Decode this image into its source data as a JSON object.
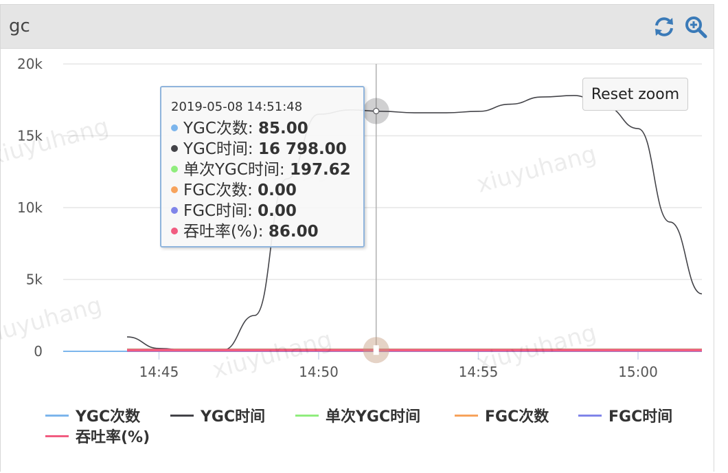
{
  "panel": {
    "title": "gc",
    "icons": [
      "refresh-icon",
      "zoom-in-icon"
    ]
  },
  "watermark": "xiuyuhang",
  "reset_zoom_label": "Reset zoom",
  "tooltip": {
    "date": "2019-05-08 14:51:48",
    "rows": [
      {
        "label": "YGC次数: ",
        "value": "85.00",
        "color": "#7cb5ec"
      },
      {
        "label": "YGC时间: ",
        "value": "16 798.00",
        "color": "#434348"
      },
      {
        "label": "单次YGC时间: ",
        "value": "197.62",
        "color": "#90ed7d"
      },
      {
        "label": "FGC次数: ",
        "value": "0.00",
        "color": "#f7a35c"
      },
      {
        "label": "FGC时间: ",
        "value": "0.00",
        "color": "#8085e9"
      },
      {
        "label": "吞吐率(%): ",
        "value": "86.00",
        "color": "#f15c80"
      }
    ]
  },
  "chart_data": {
    "type": "line",
    "title": "gc",
    "xlabel": "",
    "ylabel": "",
    "x_range": [
      "14:42",
      "15:02"
    ],
    "y_range": [
      0,
      20000
    ],
    "y_ticks": [
      0,
      5000,
      10000,
      15000,
      20000
    ],
    "y_tick_labels": [
      "0",
      "5k",
      "10k",
      "15k",
      "20k"
    ],
    "x_ticks": [
      "14:45",
      "14:50",
      "14:55",
      "15:00"
    ],
    "grid": true,
    "legend_position": "bottom",
    "crosshair_time": "14:51:48",
    "series": [
      {
        "name": "YGC次数",
        "color": "#7cb5ec",
        "points": [
          [
            "14:42",
            0
          ],
          [
            "14:44",
            0
          ]
        ]
      },
      {
        "name": "YGC时间",
        "color": "#434348",
        "points": [
          [
            "14:44",
            1000
          ],
          [
            "14:45",
            200
          ],
          [
            "14:46",
            50
          ],
          [
            "14:47",
            80
          ],
          [
            "14:48",
            2500
          ],
          [
            "14:49",
            12000
          ],
          [
            "14:50",
            16500
          ],
          [
            "14:51",
            16800
          ],
          [
            "14:52",
            16700
          ],
          [
            "14:53",
            16600
          ],
          [
            "14:54",
            16600
          ],
          [
            "14:55",
            16700
          ],
          [
            "14:56",
            17200
          ],
          [
            "14:57",
            17700
          ],
          [
            "14:58",
            17800
          ],
          [
            "14:59",
            17000
          ],
          [
            "15:00",
            15500
          ],
          [
            "15:01",
            9000
          ],
          [
            "15:02",
            4000
          ]
        ]
      },
      {
        "name": "单次YGC时间",
        "color": "#90ed7d",
        "points": [
          [
            "14:44",
            150
          ],
          [
            "15:02",
            150
          ]
        ]
      },
      {
        "name": "FGC次数",
        "color": "#f7a35c",
        "points": [
          [
            "14:44",
            0
          ],
          [
            "15:02",
            0
          ]
        ]
      },
      {
        "name": "FGC时间",
        "color": "#8085e9",
        "points": [
          [
            "14:44",
            0
          ],
          [
            "15:02",
            0
          ]
        ]
      },
      {
        "name": "吞吐率(%)",
        "color": "#f15c80",
        "points": [
          [
            "14:44",
            86
          ],
          [
            "15:02",
            86
          ]
        ]
      }
    ]
  },
  "legend": {
    "items": [
      {
        "name": "YGC次数",
        "color": "#7cb5ec"
      },
      {
        "name": "YGC时间",
        "color": "#434348"
      },
      {
        "name": "单次YGC时间",
        "color": "#90ed7d"
      },
      {
        "name": "FGC次数",
        "color": "#f7a35c"
      },
      {
        "name": "FGC时间",
        "color": "#8085e9"
      },
      {
        "name": "吞吐率(%)",
        "color": "#f15c80"
      }
    ]
  }
}
